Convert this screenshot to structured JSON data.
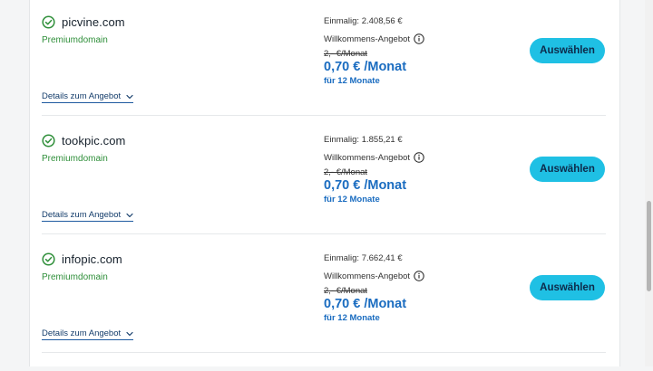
{
  "colors": {
    "accent_button": "#1fc0e4",
    "price_blue": "#1a6cc0",
    "premium_green": "#2f8f3a",
    "link_navy": "#143d6b"
  },
  "offers": [
    {
      "domain": "picvine.com",
      "badge": "Premiumdomain",
      "one_time": "Einmalig: 2.408,56 €",
      "welcome_label": "Willkommens-Angebot",
      "old_price": "2,- €/Monat",
      "new_price": "0,70 € /Monat",
      "duration": "für 12 Monate",
      "button_label": "Auswählen",
      "details_label": "Details zum Angebot"
    },
    {
      "domain": "tookpic.com",
      "badge": "Premiumdomain",
      "one_time": "Einmalig: 1.855,21 €",
      "welcome_label": "Willkommens-Angebot",
      "old_price": "2,- €/Monat",
      "new_price": "0,70 € /Monat",
      "duration": "für 12 Monate",
      "button_label": "Auswählen",
      "details_label": "Details zum Angebot"
    },
    {
      "domain": "infopic.com",
      "badge": "Premiumdomain",
      "one_time": "Einmalig: 7.662,41 €",
      "welcome_label": "Willkommens-Angebot",
      "old_price": "2,- €/Monat",
      "new_price": "0,70 € /Monat",
      "duration": "für 12 Monate",
      "button_label": "Auswählen",
      "details_label": "Details zum Angebot"
    }
  ]
}
